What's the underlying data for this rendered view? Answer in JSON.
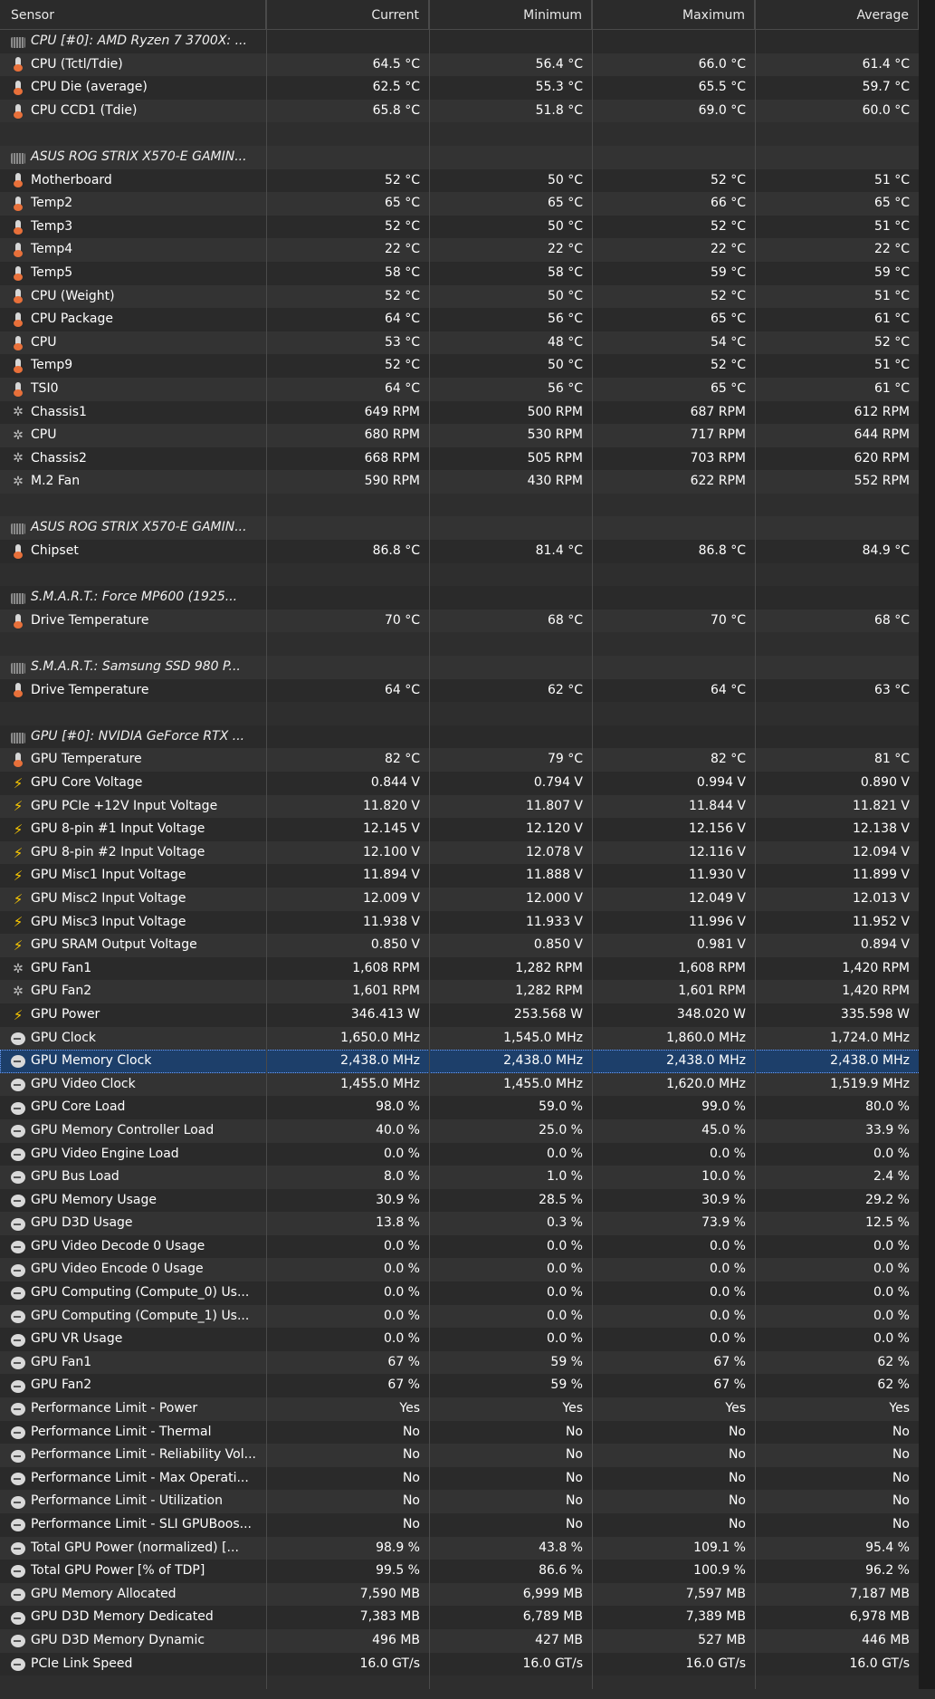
{
  "columns": {
    "sensor": "Sensor",
    "current": "Current",
    "minimum": "Minimum",
    "maximum": "Maximum",
    "average": "Average"
  },
  "rows": [
    {
      "type": "group",
      "icon": "chip-icon",
      "label": "CPU [#0]: AMD Ryzen 7 3700X: ..."
    },
    {
      "type": "data",
      "icon": "thermometer-icon",
      "label": "CPU (Tctl/Tdie)",
      "current": "64.5 °C",
      "minimum": "56.4 °C",
      "maximum": "66.0 °C",
      "average": "61.4 °C"
    },
    {
      "type": "data",
      "icon": "thermometer-icon",
      "label": "CPU Die (average)",
      "current": "62.5 °C",
      "minimum": "55.3 °C",
      "maximum": "65.5 °C",
      "average": "59.7 °C"
    },
    {
      "type": "data",
      "icon": "thermometer-icon",
      "label": "CPU CCD1 (Tdie)",
      "current": "65.8 °C",
      "minimum": "51.8 °C",
      "maximum": "69.0 °C",
      "average": "60.0 °C"
    },
    {
      "type": "blank"
    },
    {
      "type": "group",
      "icon": "chip-icon",
      "label": "ASUS ROG STRIX X570-E GAMIN..."
    },
    {
      "type": "data",
      "icon": "thermometer-icon",
      "label": "Motherboard",
      "current": "52 °C",
      "minimum": "50 °C",
      "maximum": "52 °C",
      "average": "51 °C"
    },
    {
      "type": "data",
      "icon": "thermometer-icon",
      "label": "Temp2",
      "current": "65 °C",
      "minimum": "65 °C",
      "maximum": "66 °C",
      "average": "65 °C"
    },
    {
      "type": "data",
      "icon": "thermometer-icon",
      "label": "Temp3",
      "current": "52 °C",
      "minimum": "50 °C",
      "maximum": "52 °C",
      "average": "51 °C"
    },
    {
      "type": "data",
      "icon": "thermometer-icon",
      "label": "Temp4",
      "current": "22 °C",
      "minimum": "22 °C",
      "maximum": "22 °C",
      "average": "22 °C"
    },
    {
      "type": "data",
      "icon": "thermometer-icon",
      "label": "Temp5",
      "current": "58 °C",
      "minimum": "58 °C",
      "maximum": "59 °C",
      "average": "59 °C"
    },
    {
      "type": "data",
      "icon": "thermometer-icon",
      "label": "CPU (Weight)",
      "current": "52 °C",
      "minimum": "50 °C",
      "maximum": "52 °C",
      "average": "51 °C"
    },
    {
      "type": "data",
      "icon": "thermometer-icon",
      "label": "CPU Package",
      "current": "64 °C",
      "minimum": "56 °C",
      "maximum": "65 °C",
      "average": "61 °C"
    },
    {
      "type": "data",
      "icon": "thermometer-icon",
      "label": "CPU",
      "current": "53 °C",
      "minimum": "48 °C",
      "maximum": "54 °C",
      "average": "52 °C"
    },
    {
      "type": "data",
      "icon": "thermometer-icon",
      "label": "Temp9",
      "current": "52 °C",
      "minimum": "50 °C",
      "maximum": "52 °C",
      "average": "51 °C"
    },
    {
      "type": "data",
      "icon": "thermometer-icon",
      "label": "TSI0",
      "current": "64 °C",
      "minimum": "56 °C",
      "maximum": "65 °C",
      "average": "61 °C"
    },
    {
      "type": "data",
      "icon": "fan-icon",
      "label": "Chassis1",
      "current": "649 RPM",
      "minimum": "500 RPM",
      "maximum": "687 RPM",
      "average": "612 RPM"
    },
    {
      "type": "data",
      "icon": "fan-icon",
      "label": "CPU",
      "current": "680 RPM",
      "minimum": "530 RPM",
      "maximum": "717 RPM",
      "average": "644 RPM"
    },
    {
      "type": "data",
      "icon": "fan-icon",
      "label": "Chassis2",
      "current": "668 RPM",
      "minimum": "505 RPM",
      "maximum": "703 RPM",
      "average": "620 RPM"
    },
    {
      "type": "data",
      "icon": "fan-icon",
      "label": "M.2 Fan",
      "current": "590 RPM",
      "minimum": "430 RPM",
      "maximum": "622 RPM",
      "average": "552 RPM"
    },
    {
      "type": "blank"
    },
    {
      "type": "group",
      "icon": "chip-icon",
      "label": "ASUS ROG STRIX X570-E GAMIN..."
    },
    {
      "type": "data",
      "icon": "thermometer-icon",
      "label": "Chipset",
      "current": "86.8 °C",
      "minimum": "81.4 °C",
      "maximum": "86.8 °C",
      "average": "84.9 °C"
    },
    {
      "type": "blank"
    },
    {
      "type": "group",
      "icon": "chip-icon",
      "label": "S.M.A.R.T.: Force MP600 (1925..."
    },
    {
      "type": "data",
      "icon": "thermometer-icon",
      "label": "Drive Temperature",
      "current": "70 °C",
      "minimum": "68 °C",
      "maximum": "70 °C",
      "average": "68 °C"
    },
    {
      "type": "blank"
    },
    {
      "type": "group",
      "icon": "chip-icon",
      "label": "S.M.A.R.T.: Samsung SSD 980 P..."
    },
    {
      "type": "data",
      "icon": "thermometer-icon",
      "label": "Drive Temperature",
      "current": "64 °C",
      "minimum": "62 °C",
      "maximum": "64 °C",
      "average": "63 °C"
    },
    {
      "type": "blank"
    },
    {
      "type": "group",
      "icon": "chip-icon",
      "label": "GPU [#0]: NVIDIA GeForce RTX ..."
    },
    {
      "type": "data",
      "icon": "thermometer-icon",
      "label": "GPU Temperature",
      "current": "82 °C",
      "minimum": "79 °C",
      "maximum": "82 °C",
      "average": "81 °C"
    },
    {
      "type": "data",
      "icon": "voltage-icon",
      "label": "GPU Core Voltage",
      "current": "0.844 V",
      "minimum": "0.794 V",
      "maximum": "0.994 V",
      "average": "0.890 V"
    },
    {
      "type": "data",
      "icon": "voltage-icon",
      "label": "GPU PCIe +12V Input Voltage",
      "current": "11.820 V",
      "minimum": "11.807 V",
      "maximum": "11.844 V",
      "average": "11.821 V"
    },
    {
      "type": "data",
      "icon": "voltage-icon",
      "label": "GPU 8-pin #1 Input Voltage",
      "current": "12.145 V",
      "minimum": "12.120 V",
      "maximum": "12.156 V",
      "average": "12.138 V"
    },
    {
      "type": "data",
      "icon": "voltage-icon",
      "label": "GPU 8-pin #2 Input Voltage",
      "current": "12.100 V",
      "minimum": "12.078 V",
      "maximum": "12.116 V",
      "average": "12.094 V"
    },
    {
      "type": "data",
      "icon": "voltage-icon",
      "label": "GPU Misc1 Input Voltage",
      "current": "11.894 V",
      "minimum": "11.888 V",
      "maximum": "11.930 V",
      "average": "11.899 V"
    },
    {
      "type": "data",
      "icon": "voltage-icon",
      "label": "GPU Misc2 Input Voltage",
      "current": "12.009 V",
      "minimum": "12.000 V",
      "maximum": "12.049 V",
      "average": "12.013 V"
    },
    {
      "type": "data",
      "icon": "voltage-icon",
      "label": "GPU Misc3 Input Voltage",
      "current": "11.938 V",
      "minimum": "11.933 V",
      "maximum": "11.996 V",
      "average": "11.952 V"
    },
    {
      "type": "data",
      "icon": "voltage-icon",
      "label": "GPU SRAM Output Voltage",
      "current": "0.850 V",
      "minimum": "0.850 V",
      "maximum": "0.981 V",
      "average": "0.894 V"
    },
    {
      "type": "data",
      "icon": "fan-icon",
      "label": "GPU Fan1",
      "current": "1,608 RPM",
      "minimum": "1,282 RPM",
      "maximum": "1,608 RPM",
      "average": "1,420 RPM"
    },
    {
      "type": "data",
      "icon": "fan-icon",
      "label": "GPU Fan2",
      "current": "1,601 RPM",
      "minimum": "1,282 RPM",
      "maximum": "1,601 RPM",
      "average": "1,420 RPM"
    },
    {
      "type": "data",
      "icon": "voltage-icon",
      "label": "GPU Power",
      "current": "346.413 W",
      "minimum": "253.568 W",
      "maximum": "348.020 W",
      "average": "335.598 W"
    },
    {
      "type": "data",
      "icon": "clock-icon",
      "label": "GPU Clock",
      "current": "1,650.0 MHz",
      "minimum": "1,545.0 MHz",
      "maximum": "1,860.0 MHz",
      "average": "1,724.0 MHz"
    },
    {
      "type": "data",
      "icon": "clock-icon",
      "label": "GPU Memory Clock",
      "current": "2,438.0 MHz",
      "minimum": "2,438.0 MHz",
      "maximum": "2,438.0 MHz",
      "average": "2,438.0 MHz",
      "selected": true
    },
    {
      "type": "data",
      "icon": "clock-icon",
      "label": "GPU Video Clock",
      "current": "1,455.0 MHz",
      "minimum": "1,455.0 MHz",
      "maximum": "1,620.0 MHz",
      "average": "1,519.9 MHz"
    },
    {
      "type": "data",
      "icon": "clock-icon",
      "label": "GPU Core Load",
      "current": "98.0 %",
      "minimum": "59.0 %",
      "maximum": "99.0 %",
      "average": "80.0 %"
    },
    {
      "type": "data",
      "icon": "clock-icon",
      "label": "GPU Memory Controller Load",
      "current": "40.0 %",
      "minimum": "25.0 %",
      "maximum": "45.0 %",
      "average": "33.9 %"
    },
    {
      "type": "data",
      "icon": "clock-icon",
      "label": "GPU Video Engine Load",
      "current": "0.0 %",
      "minimum": "0.0 %",
      "maximum": "0.0 %",
      "average": "0.0 %"
    },
    {
      "type": "data",
      "icon": "clock-icon",
      "label": "GPU Bus Load",
      "current": "8.0 %",
      "minimum": "1.0 %",
      "maximum": "10.0 %",
      "average": "2.4 %"
    },
    {
      "type": "data",
      "icon": "clock-icon",
      "label": "GPU Memory Usage",
      "current": "30.9 %",
      "minimum": "28.5 %",
      "maximum": "30.9 %",
      "average": "29.2 %"
    },
    {
      "type": "data",
      "icon": "clock-icon",
      "label": "GPU D3D Usage",
      "current": "13.8 %",
      "minimum": "0.3 %",
      "maximum": "73.9 %",
      "average": "12.5 %"
    },
    {
      "type": "data",
      "icon": "clock-icon",
      "label": "GPU Video Decode 0 Usage",
      "current": "0.0 %",
      "minimum": "0.0 %",
      "maximum": "0.0 %",
      "average": "0.0 %"
    },
    {
      "type": "data",
      "icon": "clock-icon",
      "label": "GPU Video Encode 0 Usage",
      "current": "0.0 %",
      "minimum": "0.0 %",
      "maximum": "0.0 %",
      "average": "0.0 %"
    },
    {
      "type": "data",
      "icon": "clock-icon",
      "label": "GPU Computing (Compute_0) Us...",
      "current": "0.0 %",
      "minimum": "0.0 %",
      "maximum": "0.0 %",
      "average": "0.0 %"
    },
    {
      "type": "data",
      "icon": "clock-icon",
      "label": "GPU Computing (Compute_1) Us...",
      "current": "0.0 %",
      "minimum": "0.0 %",
      "maximum": "0.0 %",
      "average": "0.0 %"
    },
    {
      "type": "data",
      "icon": "clock-icon",
      "label": "GPU VR Usage",
      "current": "0.0 %",
      "minimum": "0.0 %",
      "maximum": "0.0 %",
      "average": "0.0 %"
    },
    {
      "type": "data",
      "icon": "clock-icon",
      "label": "GPU Fan1",
      "current": "67 %",
      "minimum": "59 %",
      "maximum": "67 %",
      "average": "62 %"
    },
    {
      "type": "data",
      "icon": "clock-icon",
      "label": "GPU Fan2",
      "current": "67 %",
      "minimum": "59 %",
      "maximum": "67 %",
      "average": "62 %"
    },
    {
      "type": "data",
      "icon": "clock-icon",
      "label": "Performance Limit - Power",
      "current": "Yes",
      "minimum": "Yes",
      "maximum": "Yes",
      "average": "Yes"
    },
    {
      "type": "data",
      "icon": "clock-icon",
      "label": "Performance Limit - Thermal",
      "current": "No",
      "minimum": "No",
      "maximum": "No",
      "average": "No"
    },
    {
      "type": "data",
      "icon": "clock-icon",
      "label": "Performance Limit - Reliability Vol...",
      "current": "No",
      "minimum": "No",
      "maximum": "No",
      "average": "No"
    },
    {
      "type": "data",
      "icon": "clock-icon",
      "label": "Performance Limit - Max Operati...",
      "current": "No",
      "minimum": "No",
      "maximum": "No",
      "average": "No"
    },
    {
      "type": "data",
      "icon": "clock-icon",
      "label": "Performance Limit - Utilization",
      "current": "No",
      "minimum": "No",
      "maximum": "No",
      "average": "No"
    },
    {
      "type": "data",
      "icon": "clock-icon",
      "label": "Performance Limit - SLI GPUBoos...",
      "current": "No",
      "minimum": "No",
      "maximum": "No",
      "average": "No"
    },
    {
      "type": "data",
      "icon": "clock-icon",
      "label": "Total GPU Power (normalized) [...",
      "current": "98.9 %",
      "minimum": "43.8 %",
      "maximum": "109.1 %",
      "average": "95.4 %"
    },
    {
      "type": "data",
      "icon": "clock-icon",
      "label": "Total GPU Power [% of TDP]",
      "current": "99.5 %",
      "minimum": "86.6 %",
      "maximum": "100.9 %",
      "average": "96.2 %"
    },
    {
      "type": "data",
      "icon": "clock-icon",
      "label": "GPU Memory Allocated",
      "current": "7,590 MB",
      "minimum": "6,999 MB",
      "maximum": "7,597 MB",
      "average": "7,187 MB"
    },
    {
      "type": "data",
      "icon": "clock-icon",
      "label": "GPU D3D Memory Dedicated",
      "current": "7,383 MB",
      "minimum": "6,789 MB",
      "maximum": "7,389 MB",
      "average": "6,978 MB"
    },
    {
      "type": "data",
      "icon": "clock-icon",
      "label": "GPU D3D Memory Dynamic",
      "current": "496 MB",
      "minimum": "427 MB",
      "maximum": "527 MB",
      "average": "446 MB"
    },
    {
      "type": "data",
      "icon": "clock-icon",
      "label": "PCIe Link Speed",
      "current": "16.0 GT/s",
      "minimum": "16.0 GT/s",
      "maximum": "16.0 GT/s",
      "average": "16.0 GT/s"
    },
    {
      "type": "blank"
    }
  ]
}
